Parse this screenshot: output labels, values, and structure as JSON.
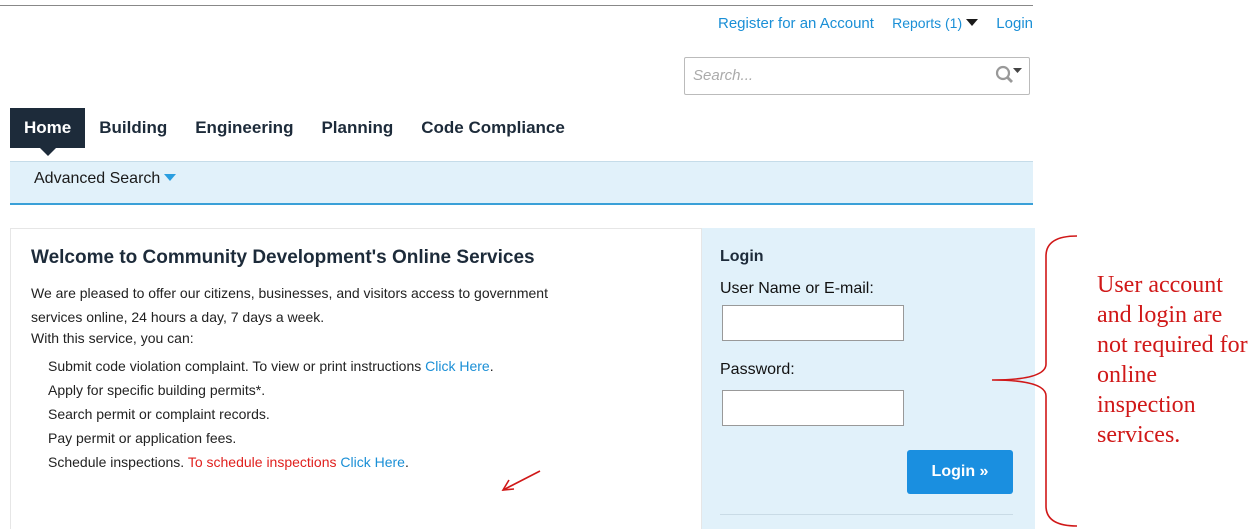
{
  "header": {
    "links": {
      "register": "Register for an Account",
      "reports": "Reports (1)",
      "login": "Login"
    }
  },
  "search": {
    "placeholder": "Search..."
  },
  "nav": {
    "tabs": [
      "Home",
      "Building",
      "Engineering",
      "Planning",
      "Code Compliance"
    ],
    "active": "Home"
  },
  "subnav": {
    "advanced_search": "Advanced Search"
  },
  "welcome": {
    "title": "Welcome to Community Development's Online Services",
    "intro_line1": "We are pleased to offer our citizens, businesses, and visitors access to government",
    "intro_line2": "services online, 24 hours a day, 7 days a week.",
    "can_heading": "With this service, you can:",
    "items": [
      {
        "text": "Submit code violation complaint. To view or print instructions ",
        "link": "Click Here",
        "suffix": "."
      },
      {
        "text": "Apply for specific building permits*."
      },
      {
        "text": "Search permit or complaint records."
      },
      {
        "text": "Pay permit or application fees."
      },
      {
        "text": "Schedule inspections. ",
        "red": "To schedule inspections ",
        "link": "Click Here",
        "suffix": "."
      }
    ]
  },
  "login": {
    "title": "Login",
    "username_label": "User Name or E-mail:",
    "password_label": "Password:",
    "button": "Login »"
  },
  "annotation": {
    "text": "User account and login are not required for online inspection services."
  },
  "colors": {
    "link": "#1a8fd6",
    "nav_dark": "#1d2b3a",
    "panel_bg": "#e1f1fa",
    "button": "#1a8fe0",
    "annotation_red": "#d01818"
  },
  "icons": {
    "search": "magnifier-icon",
    "dropdown": "caret-down-icon"
  }
}
